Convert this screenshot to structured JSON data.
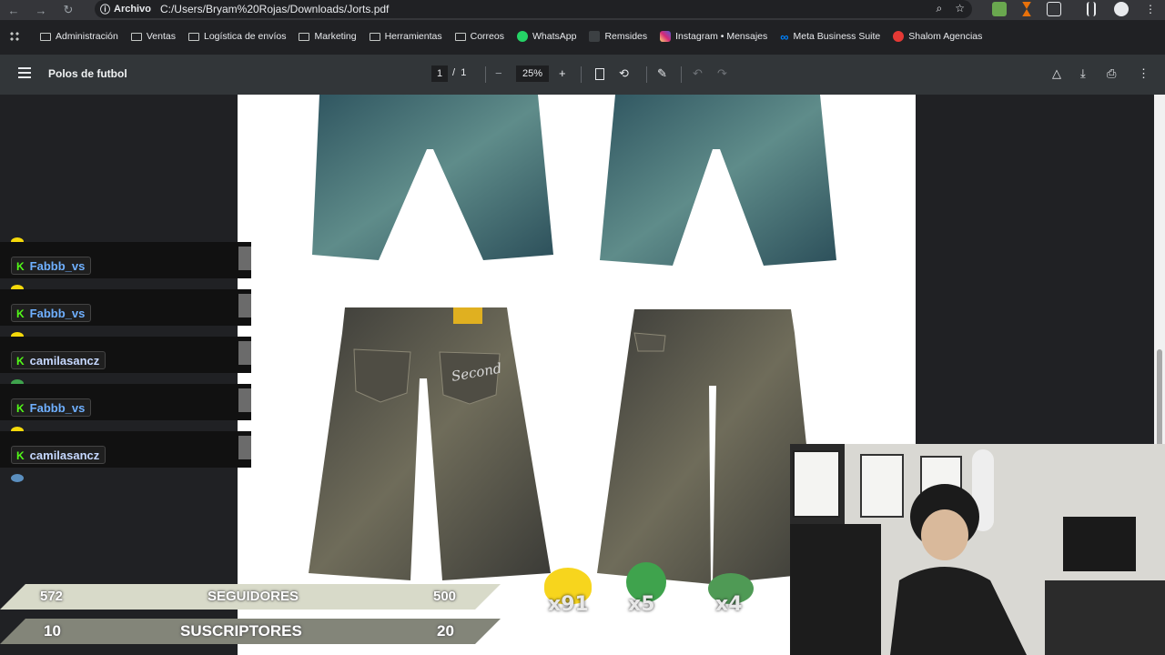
{
  "browser": {
    "site_chip": "Archivo",
    "url": "C:/Users/Bryam%20Rojas/Downloads/Jorts.pdf"
  },
  "bookmarks": [
    {
      "label": "Administración",
      "icon": "folder-icon"
    },
    {
      "label": "Ventas",
      "icon": "folder-icon"
    },
    {
      "label": "Logística de envíos",
      "icon": "folder-icon"
    },
    {
      "label": "Marketing",
      "icon": "folder-icon"
    },
    {
      "label": "Herramientas",
      "icon": "folder-icon"
    },
    {
      "label": "Correos",
      "icon": "folder-icon"
    },
    {
      "label": "WhatsApp",
      "icon": "whatsapp-icon",
      "color": "#25d366"
    },
    {
      "label": "Remsides",
      "icon": "remsides-icon",
      "color": "#3c4043"
    },
    {
      "label": "Instagram • Mensajes",
      "icon": "instagram-icon",
      "color": "#d6249f"
    },
    {
      "label": "Meta Business Suite",
      "icon": "meta-icon",
      "color": "#0081fb"
    },
    {
      "label": "Shalom Agencias",
      "icon": "shalom-icon",
      "color": "#e53935"
    }
  ],
  "pdf": {
    "title": "Polos de futbol",
    "current_page": "1",
    "separator": "/",
    "total_pages": "1",
    "zoom": "25%",
    "zoom_out": "−",
    "zoom_in": "+"
  },
  "chat": {
    "messages": [
      {
        "user": "Fabbb_vs",
        "emote": "#f5d90a"
      },
      {
        "user": "Fabbb_vs",
        "emote": "#f5d90a"
      },
      {
        "user": "camilasancz",
        "emote": "#3fa34d"
      },
      {
        "user": "Fabbb_vs",
        "emote": "#f5d90a"
      },
      {
        "user": "camilasancz",
        "emote": "#5b8fbf"
      }
    ],
    "platform_badge": "K"
  },
  "overlay": {
    "followers": {
      "current": "572",
      "label": "SEGUIDORES",
      "goal": "500"
    },
    "subs": {
      "current": "10",
      "label": "SUSCRIPTORES",
      "goal": "20"
    },
    "emote_counts": [
      "x91",
      "x5",
      "x4"
    ]
  },
  "colors": {
    "denim_blue": "#3f6d74",
    "denim_gray": "#5b5a4e",
    "accent_label": "#e0b020"
  }
}
